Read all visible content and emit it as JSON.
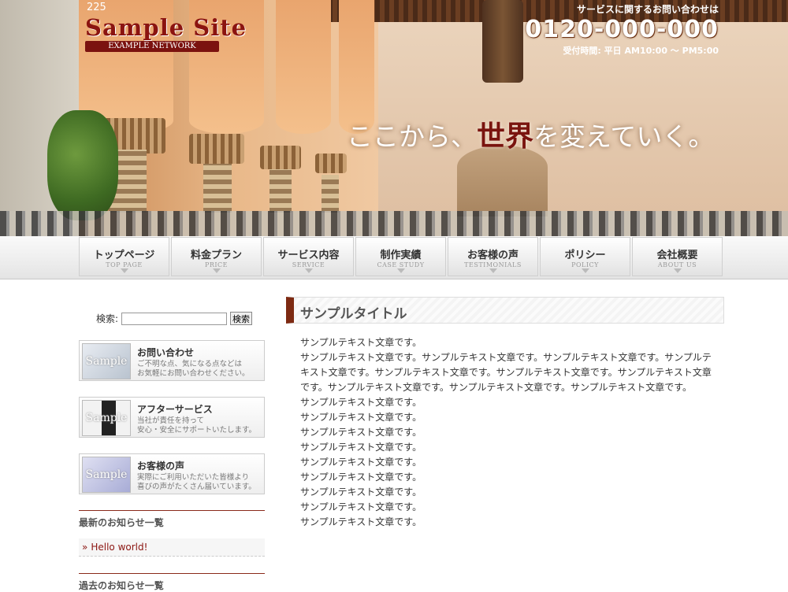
{
  "header": {
    "logo_number": "225",
    "site_title": "Sample Site",
    "site_subtitle": "EXAMPLE NETWORK",
    "contact_lead": "サービスに関するお問い合わせは",
    "phone": "0120-000-000",
    "hours": "受付時間: 平日 AM10:00 ～ PM5:00",
    "slogan_pre": "ここから、",
    "slogan_em": "世界",
    "slogan_post": "を変えていく。"
  },
  "nav": [
    {
      "jp": "トップページ",
      "en": "TOP PAGE"
    },
    {
      "jp": "料金プラン",
      "en": "PRICE"
    },
    {
      "jp": "サービス内容",
      "en": "SERVICE"
    },
    {
      "jp": "制作実績",
      "en": "CASE STUDY"
    },
    {
      "jp": "お客様の声",
      "en": "TESTIMONIALS"
    },
    {
      "jp": "ポリシー",
      "en": "POLICY"
    },
    {
      "jp": "会社概要",
      "en": "ABOUT US"
    }
  ],
  "sidebar": {
    "search_label": "検索:",
    "search_value": "",
    "search_button": "検索",
    "banners": [
      {
        "thumb": "Sample",
        "title": "お問い合わせ",
        "line1": "ご不明な点、気になる点などは",
        "line2": "お気軽にお問い合わせください。"
      },
      {
        "thumb": "Sample",
        "title": "アフターサービス",
        "line1": "当社が責任を持って",
        "line2": "安心・安全にサポートいたします。"
      },
      {
        "thumb": "Sample",
        "title": "お客様の声",
        "line1": "実際にご利用いただいた皆様より",
        "line2": "喜びの声がたくさん届いています。"
      }
    ],
    "news_heading": "最新のお知らせ一覧",
    "news_marker": "»",
    "news_items": [
      "Hello world!"
    ],
    "archive_heading": "過去のお知らせ一覧"
  },
  "main": {
    "title": "サンプルタイトル",
    "paragraph1": "サンプルテキスト文章です。",
    "paragraph2": "サンプルテキスト文章です。サンプルテキスト文章です。サンプルテキスト文章です。サンプルテキスト文章です。サンプルテキスト文章です。サンプルテキスト文章です。サンプルテキスト文章です。サンプルテキスト文章です。サンプルテキスト文章です。サンプルテキスト文章です。",
    "lines": [
      "サンプルテキスト文章です。",
      "サンプルテキスト文章です。",
      "サンプルテキスト文章です。",
      "サンプルテキスト文章です。",
      "サンプルテキスト文章です。",
      "サンプルテキスト文章です。",
      "サンプルテキスト文章です。",
      "サンプルテキスト文章です。",
      "サンプルテキスト文章です。"
    ]
  },
  "colors": {
    "accent": "#7d2a12",
    "logo_red": "#8b1410"
  }
}
